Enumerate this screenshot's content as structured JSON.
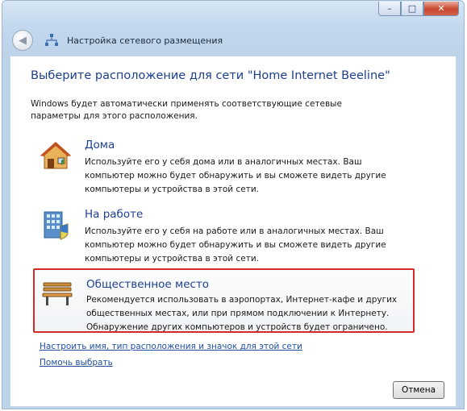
{
  "window": {
    "title": "Настройка сетевого размещения",
    "controls": {
      "minimize": "–",
      "maximize": "□",
      "close": "✕"
    }
  },
  "heading": "Выберите расположение для сети \"Home Internet Beeline\"",
  "intro": "Windows будет автоматически применять соответствующие сетевые параметры для этого расположения.",
  "options": [
    {
      "title": "Дома",
      "description": "Используйте его у себя дома или в аналогичных местах. Ваш компьютер можно будет обнаружить и вы сможете видеть другие компьютеры и устройства в этой сети.",
      "icon": "house-icon"
    },
    {
      "title": "На работе",
      "description": "Используйте его у себя на работе или в аналогичных местах. Ваш компьютер можно будет обнаружить и вы сможете видеть другие компьютеры и устройства в этой сети.",
      "icon": "office-building-icon"
    },
    {
      "title": "Общественное место",
      "description": "Рекомендуется использовать в аэропортах, Интернет-кафе и других общественных местах, или при прямом подключении к Интернету. Обнаружение других компьютеров и устройств будет ограничено.",
      "icon": "park-bench-icon",
      "highlight_color": "#d32a2a"
    }
  ],
  "links": {
    "customize": "Настроить имя, тип расположения и значок для этой сети",
    "help": "Помочь выбрать"
  },
  "buttons": {
    "cancel": "Отмена"
  },
  "colors": {
    "accent": "#1e3f8f",
    "link": "#1f4fa3",
    "highlight": "#d32a2a"
  }
}
